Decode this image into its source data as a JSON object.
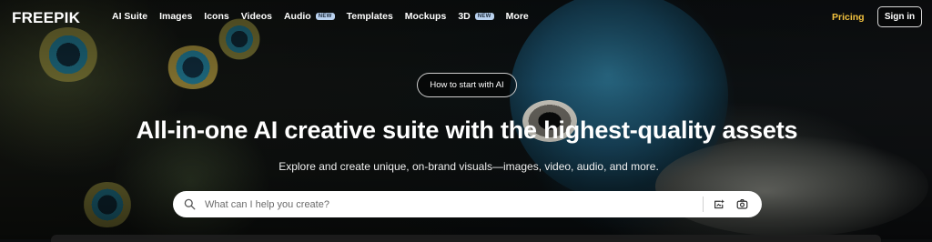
{
  "brand": {
    "logo_text": "FREEPIK"
  },
  "nav": {
    "items": [
      {
        "label": "AI Suite",
        "badge": ""
      },
      {
        "label": "Images",
        "badge": ""
      },
      {
        "label": "Icons",
        "badge": ""
      },
      {
        "label": "Videos",
        "badge": ""
      },
      {
        "label": "Audio",
        "badge": "NEW"
      },
      {
        "label": "Templates",
        "badge": ""
      },
      {
        "label": "Mockups",
        "badge": ""
      },
      {
        "label": "3D",
        "badge": "NEW"
      },
      {
        "label": "More",
        "badge": ""
      }
    ],
    "pricing_label": "Pricing",
    "signin_label": "Sign in"
  },
  "hero": {
    "howto_label": "How to start with AI",
    "headline": "All-in-one AI creative suite with the highest-quality assets",
    "subline": "Explore and create unique, on-brand visuals—images, video, audio, and more."
  },
  "search": {
    "placeholder": "What can I help you create?",
    "value": "",
    "icons": [
      "search-icon",
      "ai-image-icon",
      "camera-icon"
    ]
  },
  "colors": {
    "accent": "#f3c23f",
    "badge_bg": "#b9d1ee",
    "background": "#0b0d0e"
  }
}
